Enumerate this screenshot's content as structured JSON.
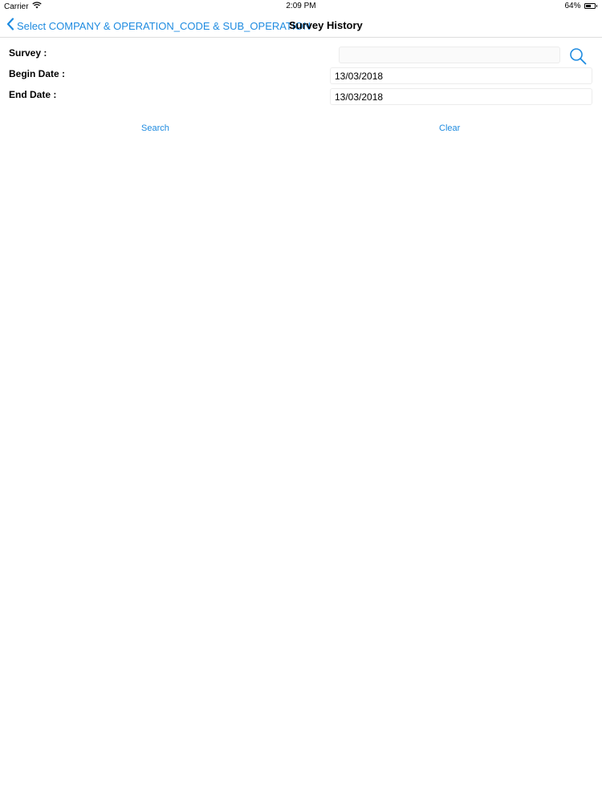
{
  "status_bar": {
    "carrier": "Carrier",
    "time": "2:09 PM",
    "battery_percent": "64%",
    "battery_level": 0.64,
    "wifi_icon": "wifi-icon",
    "battery_icon": "battery-icon"
  },
  "nav": {
    "back_label": "Select COMPANY & OPERATION_CODE & SUB_OPERATION",
    "back_icon": "chevron-left-icon",
    "title": "Survey History",
    "accent_color": "#1e8be0"
  },
  "form": {
    "survey_label": "Survey :",
    "survey_value": "",
    "begin_date_label": "Begin Date :",
    "begin_date_value": "13/03/2018",
    "end_date_label": "End Date :",
    "end_date_value": "13/03/2018",
    "search_icon": "search-icon"
  },
  "actions": {
    "search_label": "Search",
    "clear_label": "Clear"
  }
}
